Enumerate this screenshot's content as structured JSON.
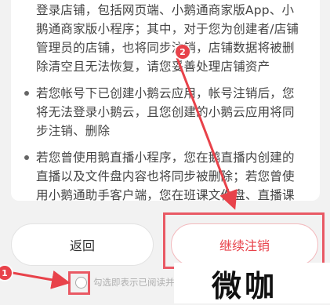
{
  "notice": {
    "lines": [
      "登录店铺，包括网页端、小鹅通商家版App、小",
      "鹅通商家版小程序；其中，对于您为创建者/店铺",
      "管理员的店铺，也将同步注销，店铺数据将被删",
      "除清空且无法恢复，请您妥善处理店铺资产",
      "若您帐号下已创建小鹅云应用，帐号注销后，您",
      "将无法登录小鹅云，且您创建的小鹅云应用将同",
      "步注销、删除",
      "若您曾使用鹅直播小程序，您在鹅直播内创建的",
      "直播以及文件盘内容也将同步被删除；若您曾使",
      "用小鹅通助手客户端，您在班课文件盘、直播课"
    ]
  },
  "buttons": {
    "back": "返回",
    "continue": "继续注销"
  },
  "agreement": {
    "text": "勾选即表示已阅读并同"
  },
  "annotations": {
    "badge_1": "1",
    "badge_2": "2",
    "highlight_color": "#e95964"
  },
  "watermark": {
    "text": "微咖"
  },
  "colors": {
    "accent": "#e8424a",
    "background": "#f2f2f2"
  }
}
